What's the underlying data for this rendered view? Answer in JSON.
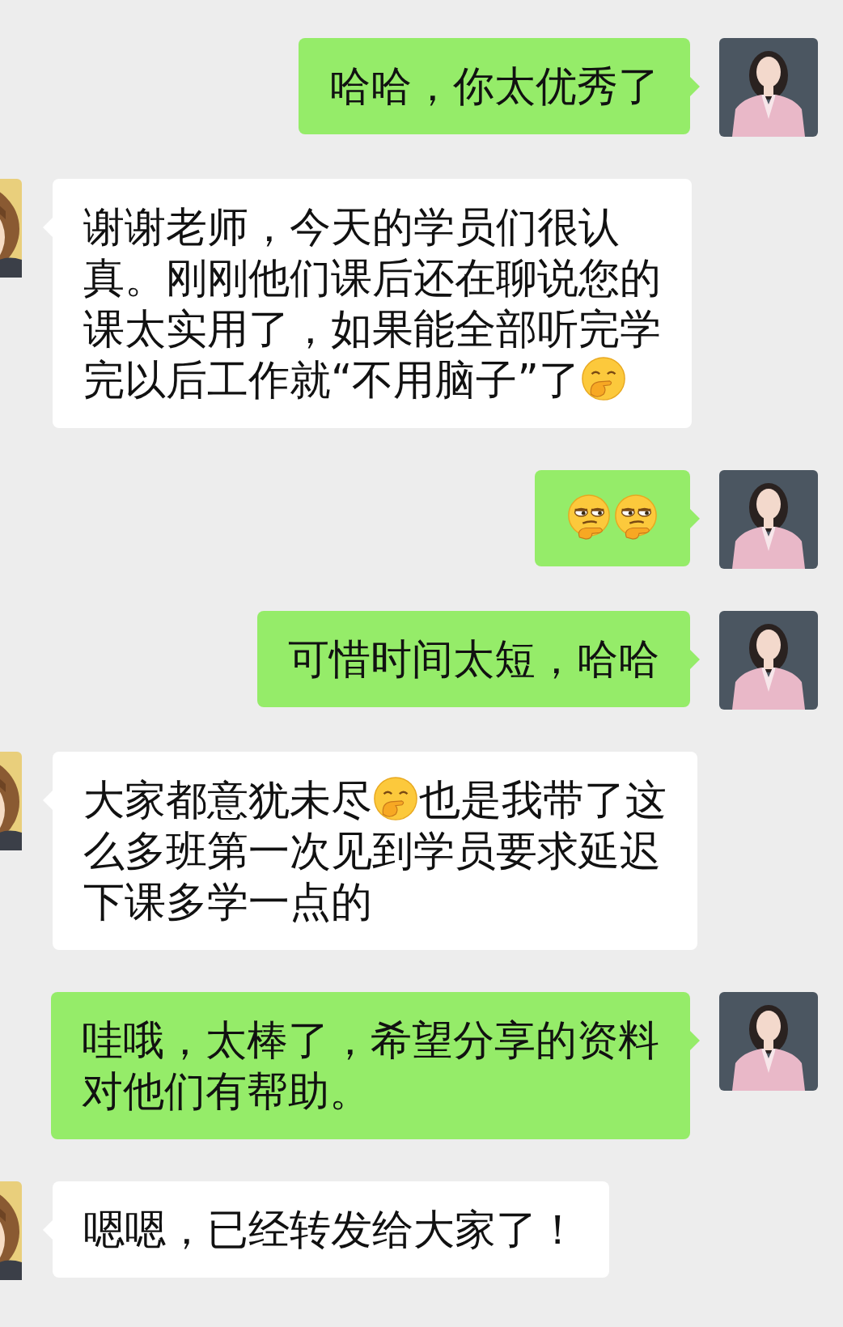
{
  "messages": [
    {
      "mine": true,
      "lines": [
        [
          {
            "kind": "text",
            "text": "哈哈，你太优秀了"
          }
        ]
      ]
    },
    {
      "mine": false,
      "lines": [
        [
          {
            "kind": "text",
            "text": "谢谢老师，今天的学员们很认"
          }
        ],
        [
          {
            "kind": "text",
            "text": "真。刚刚他们课后还在聊说您的"
          }
        ],
        [
          {
            "kind": "text",
            "text": "课太实用了，如果能全部听完学"
          }
        ],
        [
          {
            "kind": "text",
            "text": "完以后工作就“不用脑子”了"
          },
          {
            "kind": "giggle"
          }
        ]
      ]
    },
    {
      "mine": true,
      "lines": [
        [
          {
            "kind": "smirk"
          },
          {
            "kind": "smirk"
          }
        ]
      ]
    },
    {
      "mine": true,
      "lines": [
        [
          {
            "kind": "text",
            "text": "可惜时间太短，哈哈"
          }
        ]
      ]
    },
    {
      "mine": false,
      "lines": [
        [
          {
            "kind": "text",
            "text": "大家都意犹未尽"
          },
          {
            "kind": "giggle"
          },
          {
            "kind": "text",
            "text": "也是我带了这"
          }
        ],
        [
          {
            "kind": "text",
            "text": "么多班第一次见到学员要求延迟"
          }
        ],
        [
          {
            "kind": "text",
            "text": "下课多学一点的"
          }
        ]
      ]
    },
    {
      "mine": true,
      "lines": [
        [
          {
            "kind": "text",
            "text": "哇哦，太棒了，希望分享的资料"
          }
        ],
        [
          {
            "kind": "text",
            "text": "对他们有帮助。"
          }
        ]
      ]
    },
    {
      "mine": false,
      "lines": [
        [
          {
            "kind": "text",
            "text": "嗯嗯，已经转发给大家了！"
          }
        ]
      ]
    }
  ]
}
